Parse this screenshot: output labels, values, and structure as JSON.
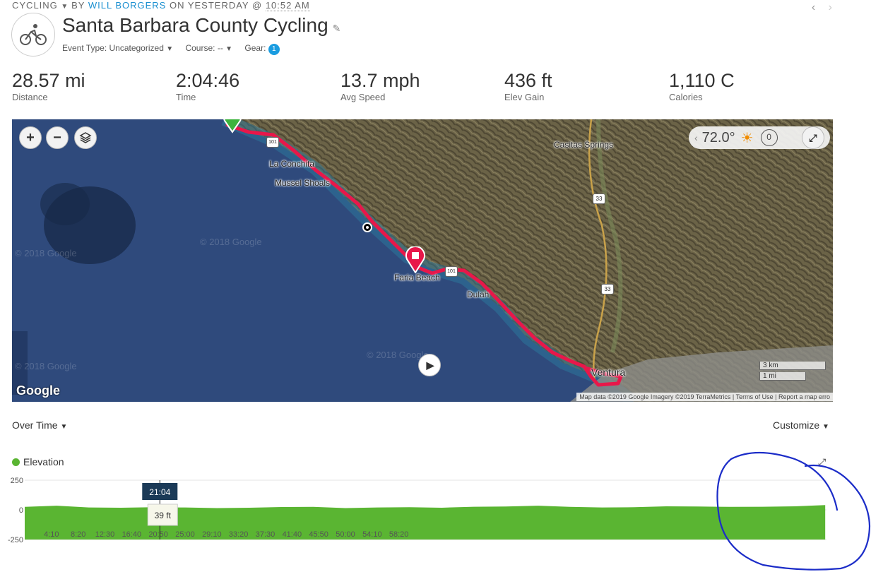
{
  "header": {
    "activity_type": "CYCLING",
    "by_text": "BY",
    "author": "WILL BORGERS",
    "on_text": "ON YESTERDAY @",
    "time": "10:52 AM",
    "title": "Santa Barbara County Cycling",
    "event_type": "Event Type: Uncategorized",
    "course": "Course: --",
    "gear_label": "Gear:",
    "gear_count": "1"
  },
  "stats": [
    {
      "value": "28.57 mi",
      "label": "Distance"
    },
    {
      "value": "2:04:46",
      "label": "Time"
    },
    {
      "value": "13.7 mph",
      "label": "Avg Speed"
    },
    {
      "value": "436 ft",
      "label": "Elev Gain"
    },
    {
      "value": "1,110 C",
      "label": "Calories"
    }
  ],
  "map": {
    "weather_temp": "72.0°",
    "wind_value": "0",
    "places": {
      "casitas": "Casitas Springs",
      "conchita": "La Conchita",
      "mussel": "Mussel Shoals",
      "faria": "Faria Beach",
      "dulah": "Dulah",
      "ventura": "Ventura"
    },
    "highway_33": "33",
    "highway_101": "101",
    "watermark": "© 2018 Google",
    "scale_km": "3 km",
    "scale_mi": "1 mi",
    "google_logo": "Google",
    "attribution": "Map data ©2019 Google Imagery ©2019 TerraMetrics",
    "terms": "Terms of Use",
    "report": "Report a map erro",
    "colors": {
      "route": "#e8174a",
      "sea": "#2f4a7c",
      "land": "#6b6347"
    }
  },
  "chart_controls": {
    "over_time": "Over Time",
    "customize": "Customize"
  },
  "chart_data": {
    "type": "area",
    "series": [
      {
        "name": "Elevation",
        "color": "#5ab532"
      }
    ],
    "ylim": [
      -250,
      250
    ],
    "y_ticks": [
      "250",
      "0",
      "-250"
    ],
    "x_ticks": [
      "4:10",
      "8:20",
      "12:30",
      "16:40",
      "20:50",
      "25:00",
      "29:10",
      "33:20",
      "37:30",
      "41:40",
      "45:50",
      "50:00",
      "54:10",
      "58:20"
    ],
    "x_minutes": [
      0,
      5,
      10,
      15,
      20,
      25,
      30,
      35,
      40,
      45,
      50,
      55,
      60,
      65,
      70,
      75,
      80,
      85,
      90,
      95,
      100,
      105,
      110,
      115,
      120,
      124.8
    ],
    "values": [
      25,
      35,
      20,
      18,
      22,
      20,
      15,
      18,
      24,
      25,
      15,
      20,
      22,
      18,
      26,
      28,
      35,
      25,
      20,
      22,
      30,
      28,
      25,
      26,
      30,
      40
    ],
    "x_range_minutes": [
      0,
      125
    ],
    "tooltip": {
      "time": "21:04",
      "value": "39 ft"
    }
  }
}
